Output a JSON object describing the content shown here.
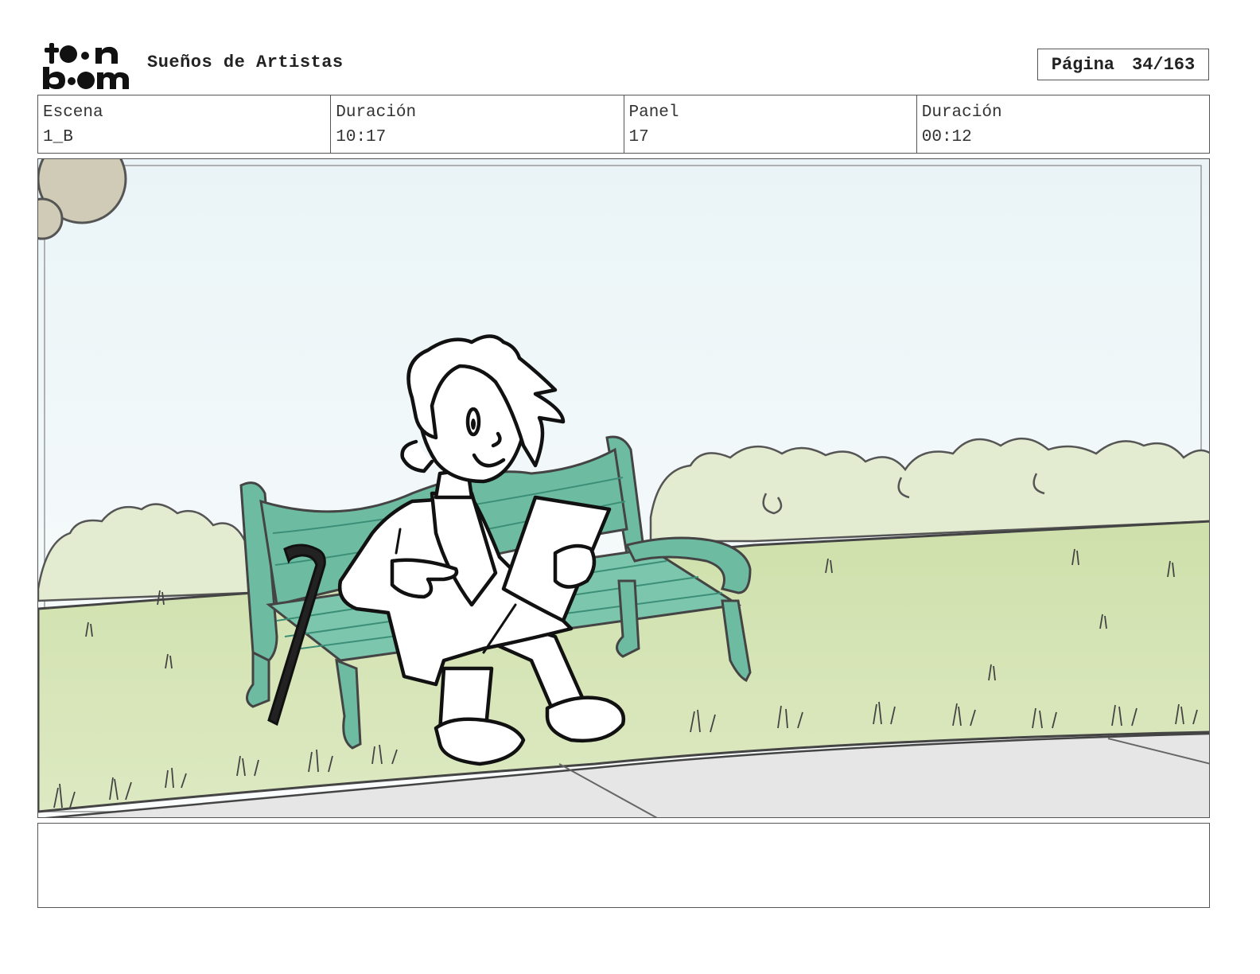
{
  "header": {
    "logo_text": [
      "to•n",
      "b•om"
    ],
    "project_title": "Sueños de Artistas",
    "page_label": "Página",
    "page_value": "34/163"
  },
  "info": {
    "scene_label": "Escena",
    "scene_value": "1_B",
    "scene_duration_label": "Duración",
    "scene_duration_value": "10:17",
    "panel_label": "Panel",
    "panel_value": "17",
    "panel_duration_label": "Duración",
    "panel_duration_value": "00:12"
  },
  "panel": {
    "image_description": "",
    "colors": {
      "sky_top": "#eef6f8",
      "sky_bottom": "#fbfdfd",
      "grass": "#d6e3b4",
      "bushes": "#e5edd3",
      "bench": "#5fb39a",
      "path": "#e6e6e6",
      "ink": "#111111"
    }
  },
  "notes": {
    "text": ""
  }
}
